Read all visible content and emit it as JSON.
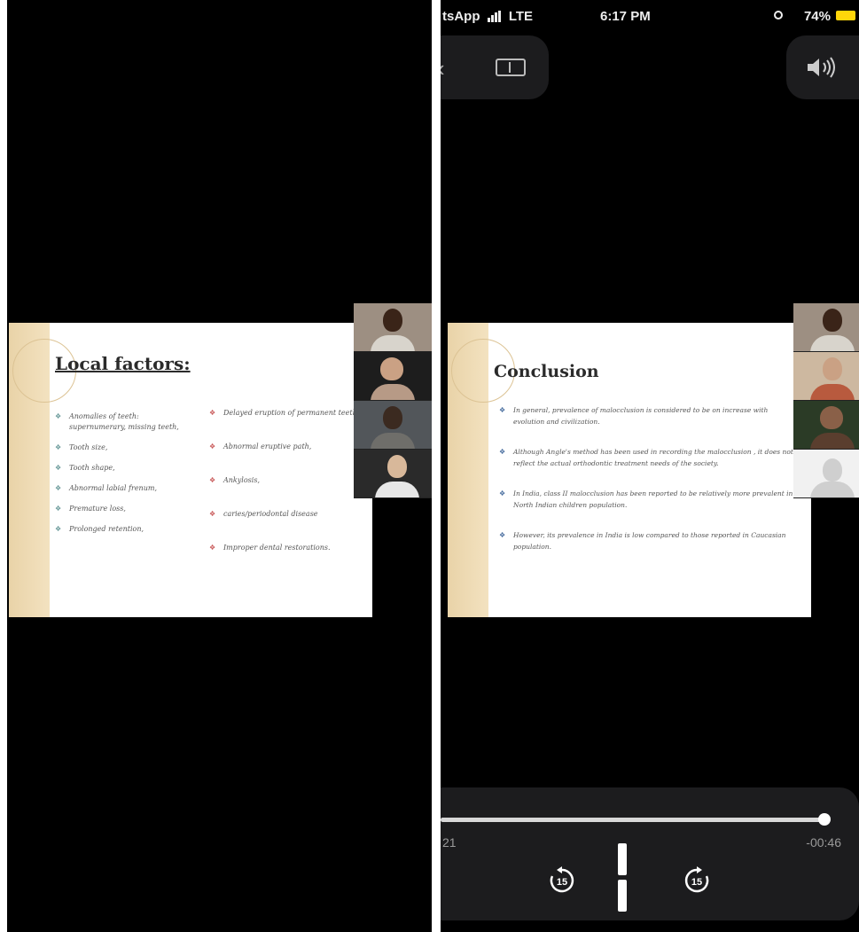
{
  "status_bar": {
    "carrier": "tsApp",
    "network": "LTE",
    "time": "6:17 PM",
    "battery": "74%"
  },
  "slide_left": {
    "title": "Local factors:",
    "column_a": [
      "Anomalies of teeth: supernumerary, missing teeth,",
      "Tooth size,",
      "Tooth shape,",
      "Abnormal labial frenum,",
      "Premature loss,",
      "Prolonged retention,"
    ],
    "column_b": [
      "Delayed eruption of permanent teeth",
      "Abnormal eruptive path,",
      "Ankylosis,",
      "caries/periodontal disease",
      "Improper dental restorations."
    ]
  },
  "slide_right": {
    "title": "Conclusion",
    "bullets": [
      "In general, prevalence of malocclusion is considered to be on increase with evolution and civilization.",
      "Although Angle's method has been used in recording the malocclusion , it does not reflect the actual orthodontic treatment needs of the society.",
      "In India, class II malocclusion has been reported to be relatively more prevalent in North Indian children population.",
      "However, its prevalence in India is low compared to those reported in Caucasian population."
    ]
  },
  "player": {
    "elapsed": "21",
    "remaining": "-00:46",
    "progress": 0.988,
    "skip_back_label": "15",
    "skip_forward_label": "15"
  },
  "colors": {
    "battery": "#ffd60a",
    "panel_bg": "#000000",
    "controls_bg": "#1c1c1e",
    "slide_strip": "#e9d3a8"
  },
  "icons": [
    "back-chevron-icon",
    "aspect-ratio-icon",
    "volume-icon",
    "skip-back-15-icon",
    "pause-icon",
    "skip-forward-15-icon",
    "location-icon",
    "battery-icon",
    "signal-icon"
  ]
}
